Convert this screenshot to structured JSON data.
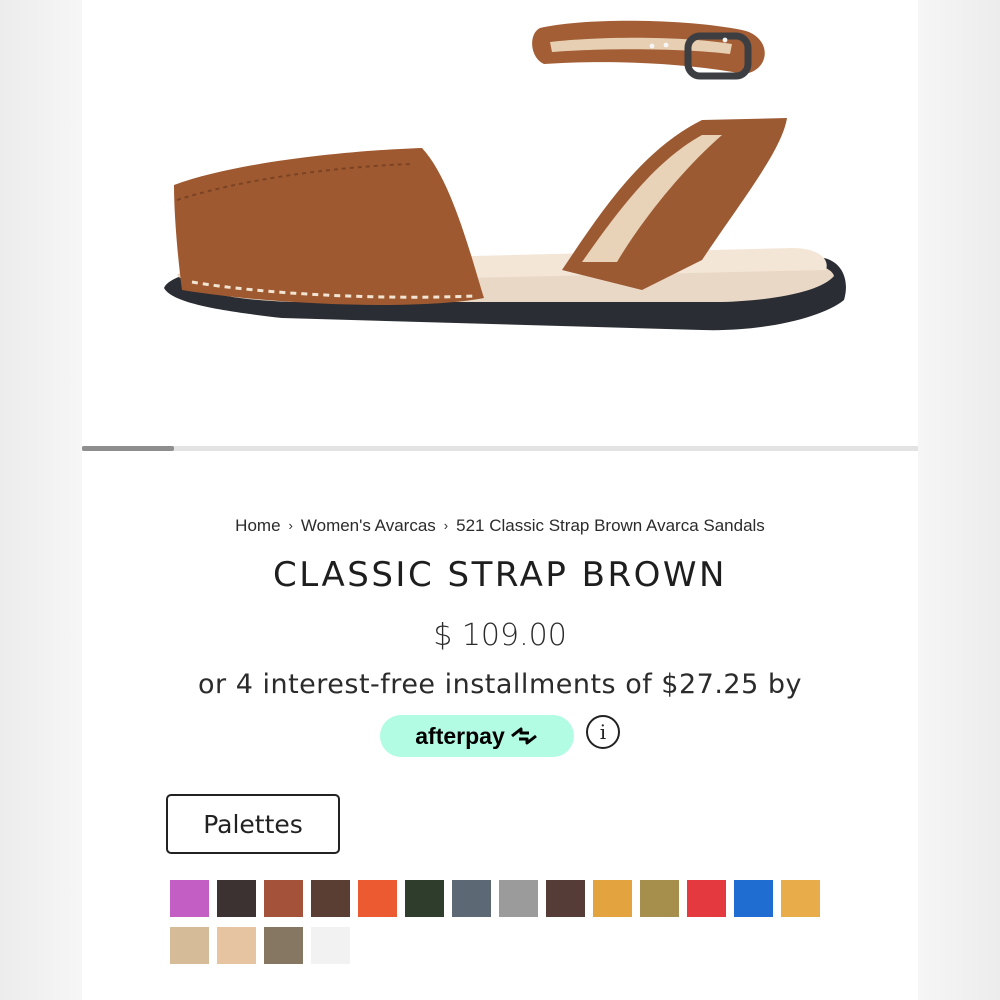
{
  "breadcrumb": {
    "items": [
      "Home",
      "Women's Avarcas",
      "521 Classic Strap Brown Avarca Sandals"
    ],
    "separator": "›"
  },
  "product": {
    "title": "CLASSIC STRAP BROWN",
    "price": "$ 109.00",
    "installments_text": "or 4 interest-free installments of $27.25 by"
  },
  "afterpay": {
    "label": "afterpay",
    "badge_color": "#b2fce4",
    "info_symbol": "i"
  },
  "palettes": {
    "label": "Palettes"
  },
  "gallery": {
    "scroll_progress": 0.11
  },
  "swatches": [
    {
      "color": "#c35fc4"
    },
    {
      "color": "#3b3231"
    },
    {
      "color": "#a4533a"
    },
    {
      "color": "#5a3d33"
    },
    {
      "color": "#ec5a32"
    },
    {
      "color": "#2f3d2c"
    },
    {
      "color": "#5c6874"
    },
    {
      "color": "#9b9b9b"
    },
    {
      "color": "#553c37"
    },
    {
      "color": "#e3a43f"
    },
    {
      "color": "#a68e4d"
    },
    {
      "color": "#e4393e"
    },
    {
      "color": "#1f6dd0"
    },
    {
      "color": "#e8ad4a"
    },
    {
      "color": "#d6bb98"
    },
    {
      "color": "#e7c4a1"
    },
    {
      "color": "#857762"
    },
    {
      "color": "#f2f2f2"
    }
  ]
}
